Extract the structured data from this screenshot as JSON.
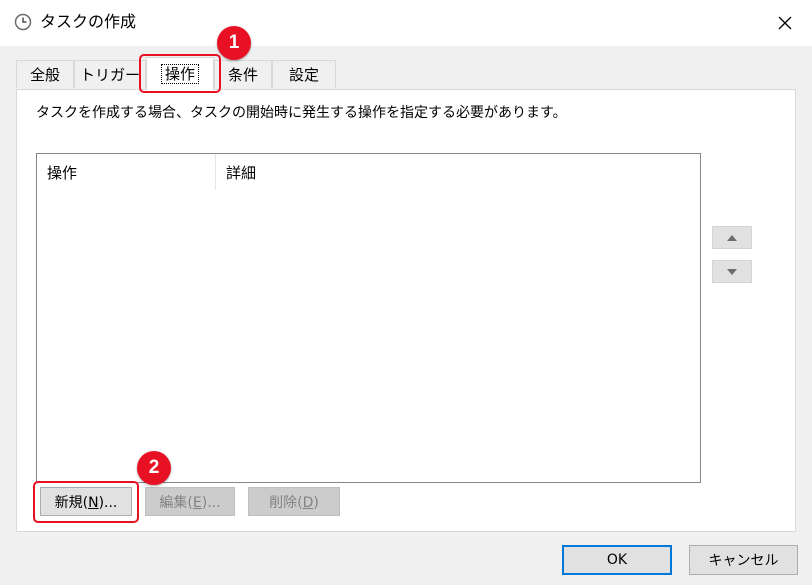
{
  "window": {
    "title": "タスクの作成",
    "title_icon": "clock-icon",
    "close_icon": "close-icon"
  },
  "tabs": [
    {
      "label": "全般",
      "active": false
    },
    {
      "label": "トリガー",
      "active": false
    },
    {
      "label": "操作",
      "active": true
    },
    {
      "label": "条件",
      "active": false
    },
    {
      "label": "設定",
      "active": false
    }
  ],
  "panel": {
    "description": "タスクを作成する場合、タスクの開始時に発生する操作を指定する必要があります。",
    "columns": [
      "操作",
      "詳細"
    ],
    "rows": []
  },
  "side_buttons": {
    "up_icon": "arrow-up-icon",
    "down_icon": "arrow-down-icon"
  },
  "buttons": {
    "new": {
      "prefix": "新規(",
      "accel": "N",
      "suffix": ")..."
    },
    "edit": {
      "prefix": "編集(",
      "accel": "E",
      "suffix": ")..."
    },
    "delete": {
      "prefix": "削除(",
      "accel": "D",
      "suffix": ")"
    },
    "ok": "OK",
    "cancel": "キャンセル"
  },
  "annotations": {
    "badge1": "1",
    "badge2": "2",
    "color": "#e81123"
  }
}
